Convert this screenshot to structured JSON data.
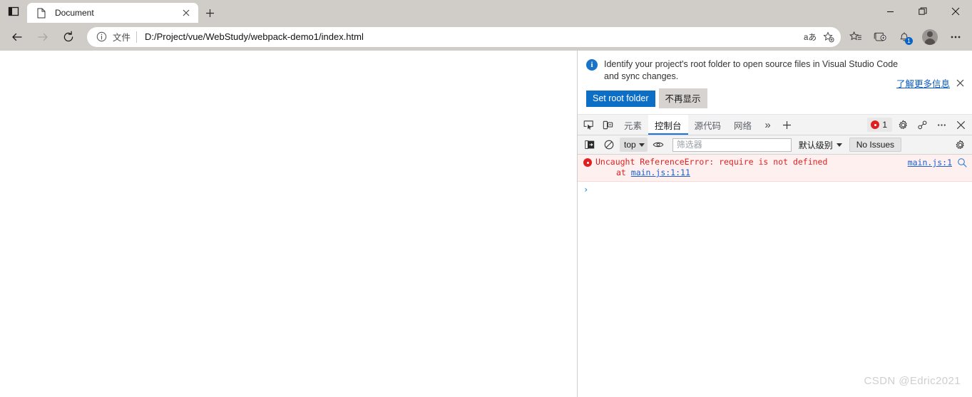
{
  "window": {
    "controls": {
      "minimize": "minimize-button",
      "restore": "restore-button",
      "close": "close-button"
    }
  },
  "tabbar": {
    "tab_actions_tooltip": "Tab actions",
    "tabs": [
      {
        "title": "Document",
        "favicon": "document-icon",
        "active": true
      }
    ],
    "new_tab_label": "+"
  },
  "navbar": {
    "back": "back-arrow",
    "forward": "forward-arrow",
    "reload": "reload-icon",
    "omnibox": {
      "info_icon": "info-circle-icon",
      "scheme_label": "文件",
      "url": "D:/Project/vue/WebStudy/webpack-demo1/index.html",
      "read_aloud": "aあ",
      "add_favorite": "add-favorite-star-icon"
    },
    "toolbar": [
      {
        "name": "favorites-icon",
        "glyph": "favorites"
      },
      {
        "name": "collections-icon",
        "glyph": "collections"
      },
      {
        "name": "notifications-icon",
        "glyph": "bell",
        "badge": "1"
      },
      {
        "name": "profile-avatar",
        "glyph": "avatar"
      },
      {
        "name": "settings-and-more-icon",
        "glyph": "ellipsis"
      }
    ]
  },
  "devtools": {
    "banner": {
      "icon": "info-icon",
      "message": "Identify your project's root folder to open source files in Visual Studio Code and sync changes.",
      "primary_button": "Set root folder",
      "secondary_button": "不再显示",
      "learn_more": "了解更多信息",
      "close": "×"
    },
    "toolbar": {
      "inspect_icon": "inspect-element-icon",
      "device_icon": "device-toolbar-icon",
      "tabs": [
        {
          "label": "元素",
          "active": false
        },
        {
          "label": "控制台",
          "active": true
        },
        {
          "label": "源代码",
          "active": false
        },
        {
          "label": "网络",
          "active": false
        }
      ],
      "more_tabs": "»",
      "add_panel": "+",
      "error_count": "1",
      "settings_icon": "gear-icon",
      "customize_icon": "devtools-customize-icon",
      "more_icon": "more-options-icon",
      "close_icon": "close-devtools-icon"
    },
    "console_filters": {
      "sidebar_toggle": "console-sidebar-icon",
      "clear_console": "clear-console-icon",
      "context": "top",
      "live_expression": "eye-icon",
      "filter_placeholder": "筛选器",
      "filter_value": "",
      "level": "默认级别",
      "issues_button": "No Issues",
      "settings": "gear-icon"
    },
    "console_messages": [
      {
        "type": "error",
        "text": "Uncaught ReferenceError: require is not defined",
        "stack_prefix": "at ",
        "stack_link": "main.js:1:11",
        "source_link": "main.js:1"
      }
    ],
    "prompt_caret": "›"
  },
  "watermark": "CSDN @Edric2021",
  "colors": {
    "chrome_bg": "#d0cdc8",
    "accent_blue": "#0c6ec4",
    "tab_active_underline": "#1a73e8",
    "error_red": "#e02020",
    "error_bg": "#fff0f0",
    "link_blue": "#1a5fd0"
  }
}
